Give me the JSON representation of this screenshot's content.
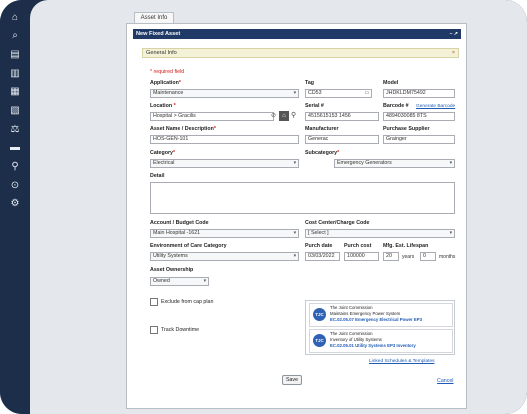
{
  "sidebar": {
    "icons": [
      {
        "name": "home-icon",
        "glyph": "⌂"
      },
      {
        "name": "search-icon",
        "glyph": "⌕"
      },
      {
        "name": "database-icon",
        "glyph": "▤"
      },
      {
        "name": "building-icon",
        "glyph": "▥"
      },
      {
        "name": "calendar-icon",
        "glyph": "▦"
      },
      {
        "name": "inventory-icon",
        "glyph": "▧"
      },
      {
        "name": "scale-icon",
        "glyph": "⚖"
      },
      {
        "name": "folder-icon",
        "glyph": "▬"
      },
      {
        "name": "location-pin-icon",
        "glyph": "⚲"
      },
      {
        "name": "ticket-icon",
        "glyph": "⊙"
      },
      {
        "name": "settings-gear-icon",
        "glyph": "⚙"
      }
    ]
  },
  "tab": {
    "label": "Asset Info"
  },
  "window": {
    "title": "New Fixed Asset",
    "controls": "– ↗"
  },
  "section": {
    "title": "General Info",
    "close": "×"
  },
  "form": {
    "required_note": "* required field",
    "application": {
      "label": "Application",
      "value": "Maintenance"
    },
    "tag": {
      "label": "Tag",
      "value": "CD53"
    },
    "model": {
      "label": "Model",
      "value": "JHDKLDM75492"
    },
    "location": {
      "label": "Location",
      "value": "Hospital > Gracilis"
    },
    "serial": {
      "label": "Serial #",
      "value": "4515615153 1456"
    },
    "barcode": {
      "label": "Barcode #",
      "value": "4894030085 8TS",
      "generate_link": "Generate Barcode"
    },
    "asset_name": {
      "label": "Asset Name / Description",
      "value": "HOS-GEN-101"
    },
    "manufacturer": {
      "label": "Manufacturer",
      "value": "Generac"
    },
    "purchase_supplier": {
      "label": "Purchase Supplier",
      "value": "Grainger"
    },
    "category": {
      "label": "Category",
      "value": "Electrical"
    },
    "subcategory": {
      "label": "Subcategory",
      "value": "Emergency Generators"
    },
    "detail": {
      "label": "Detail"
    },
    "account_budget": {
      "label": "Account / Budget Code",
      "value": "Main Hospital -1621"
    },
    "cost_center": {
      "label": "Cost Center/Charge Code",
      "value": "[ Select ]"
    },
    "environment_of_care": {
      "label": "Environment of Care Category",
      "value": "Utility Systems"
    },
    "purch_date": {
      "label": "Purch date",
      "value": "03/03/2022"
    },
    "purch_cost": {
      "label": "Purch cost",
      "value": "100000"
    },
    "mfg_lifespan": {
      "label": "Mfg. Est. Lifespan",
      "years_value": "20",
      "years_unit": "years",
      "months_value": "0",
      "months_unit": "months"
    },
    "asset_ownership": {
      "label": "Asset Ownership",
      "value": "Owned"
    },
    "exclude_cap_plan": {
      "label": "Exclude from cap plan"
    },
    "track_downtime": {
      "label": "Track Downtime"
    }
  },
  "joint_commission": {
    "cards": [
      {
        "logo": "TJC",
        "org": "The Joint Commission",
        "desc": "Maintains Emergency Power System",
        "link": "EC.02.05.07 Emergency Electrical Power EP3"
      },
      {
        "logo": "TJC",
        "org": "The Joint Commission",
        "desc": "Inventory of Utility Systems",
        "link": "EC.02.05.01 Utility Systems EP3 Inventory"
      }
    ],
    "linked_schedules": "Linked Schedules & Templates"
  },
  "actions": {
    "save": "Save",
    "cancel": "Cancel"
  }
}
